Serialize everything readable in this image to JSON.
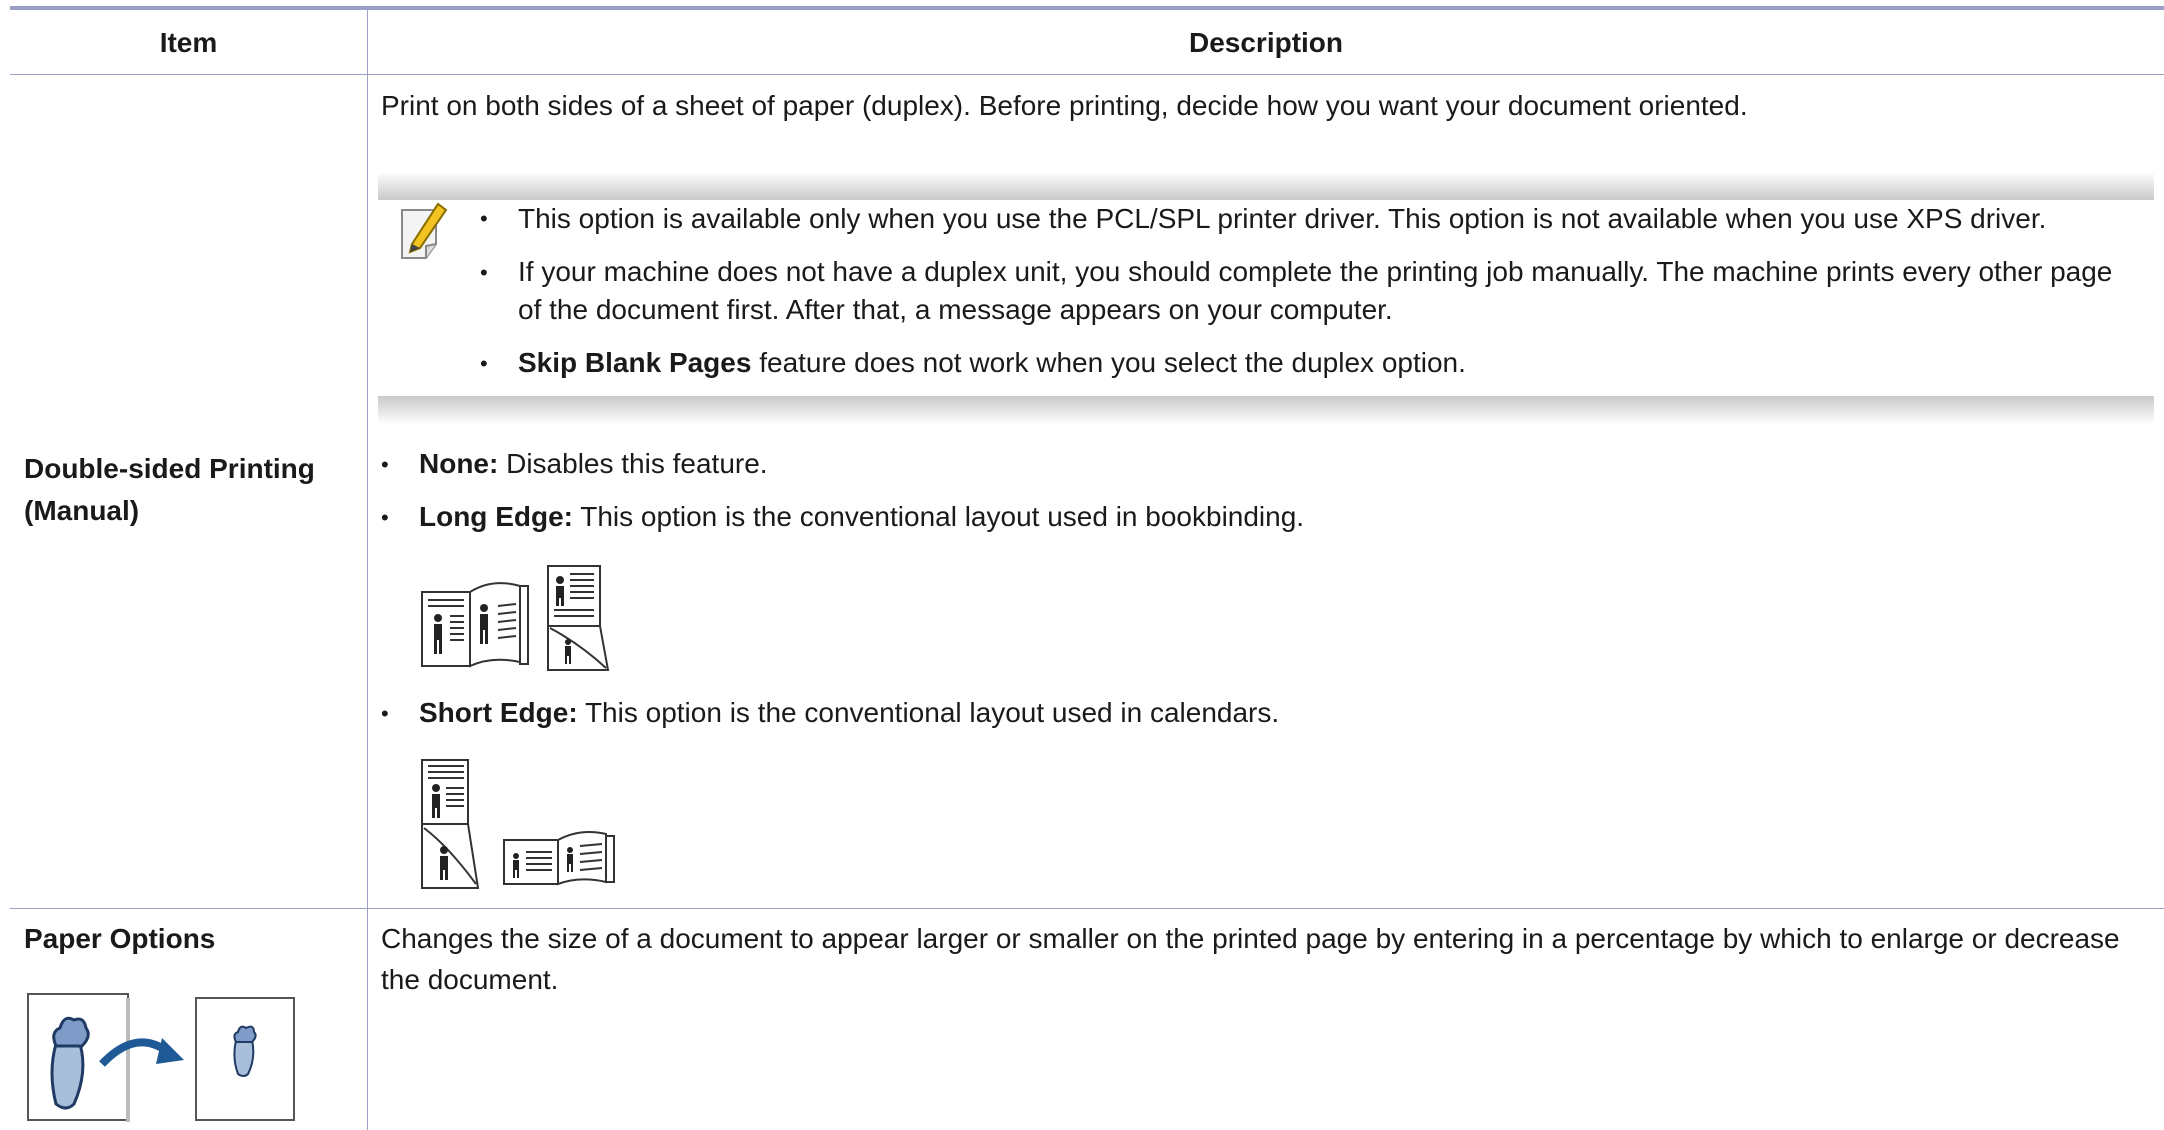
{
  "table": {
    "header": {
      "item": "Item",
      "description": "Description"
    },
    "row1": {
      "item": [
        "Double-sided Printing",
        "(Manual)"
      ],
      "intro": "Print on both sides of a sheet of paper (duplex). Before printing, decide how you want your document oriented.",
      "notes": [
        "This option is available only when you use the PCL/SPL printer driver. This option is not available when you use XPS driver.",
        "If your machine does not have a duplex unit, you should complete the printing job manually. The machine prints every other page",
        "of the document first. After that, a message appears on your computer."
      ],
      "note3_bold": "Skip Blank Pages",
      "note3_rest": " feature does not work when you select the duplex option.",
      "options": [
        {
          "term": "None:",
          "desc": " Disables this feature."
        },
        {
          "term": "Long Edge:",
          "desc": " This option is the conventional layout used in bookbinding."
        },
        {
          "term": "Short Edge:",
          "desc": " This option is the conventional layout used in calendars."
        }
      ]
    },
    "row2": {
      "item": "Paper Options",
      "desc_line1": "Changes the size of a document to appear larger or smaller on the printed page by entering in a percentage by which to enlarge or decrease",
      "desc_line2": "the document."
    }
  },
  "colors": {
    "rule": "#9b9ec7",
    "grid": "#9aa0c4",
    "arrow": "#1f5a96"
  }
}
